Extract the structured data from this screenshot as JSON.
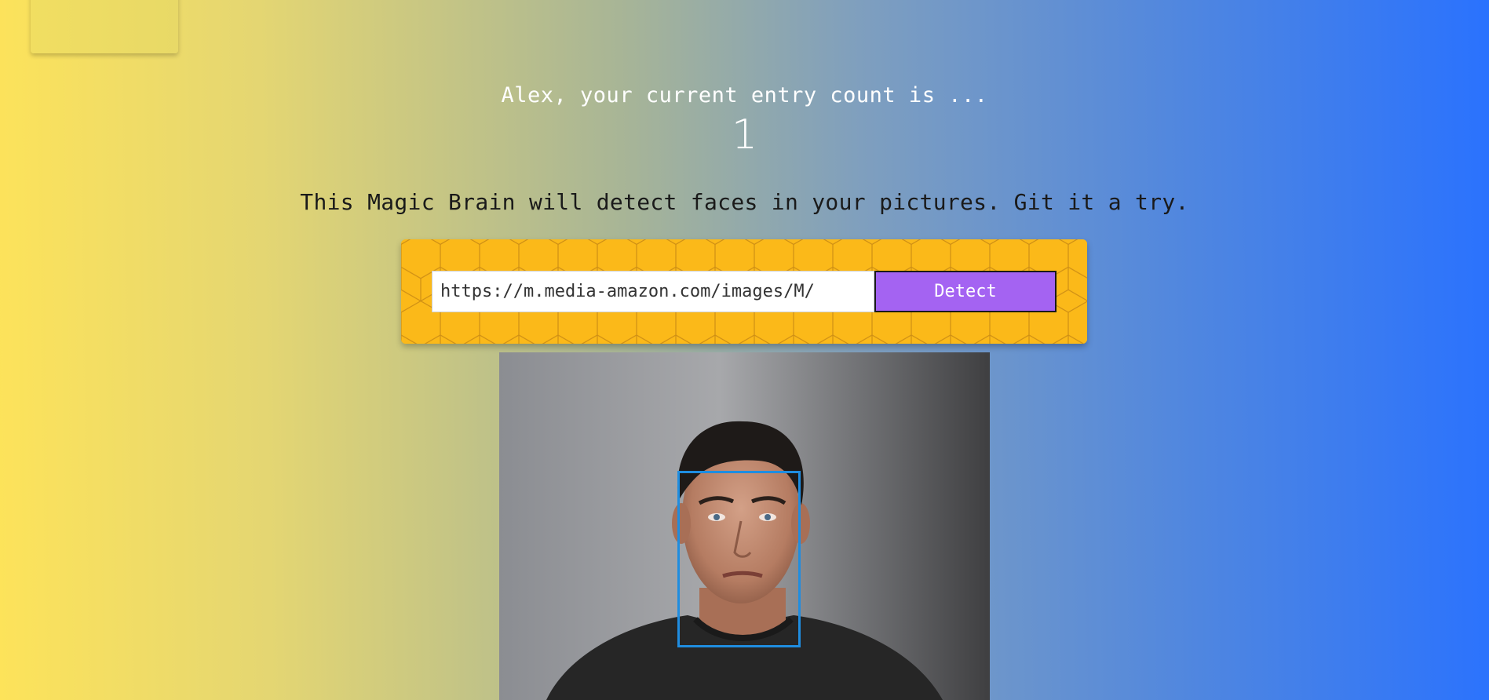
{
  "logo": {
    "name": "brain-logo-card"
  },
  "rank": {
    "greeting": "Alex, your current entry count is ...",
    "count": "1"
  },
  "tagline": "This Magic Brain will detect faces in your pictures. Git it a try.",
  "form": {
    "url_value": "https://m.media-amazon.com/images/M/",
    "detect_label": "Detect"
  },
  "image": {
    "description_icon": "portrait-photo",
    "face_box_color": "#1f8de0"
  },
  "colors": {
    "gradient_left": "#fde35a",
    "gradient_right": "#2a72fe",
    "panel": "#fbb919",
    "button": "#a463f2"
  }
}
